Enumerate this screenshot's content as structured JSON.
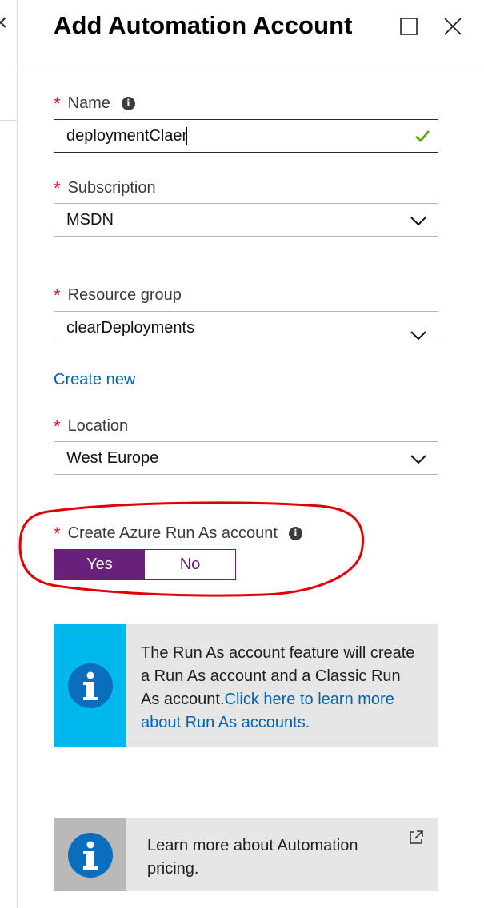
{
  "header": {
    "title": "Add Automation Account"
  },
  "form": {
    "name": {
      "label": "Name",
      "value": "deploymentClaer"
    },
    "subscription": {
      "label": "Subscription",
      "value": "MSDN"
    },
    "resource_group": {
      "label": "Resource group",
      "value": "clearDeployments",
      "create_new": "Create new"
    },
    "location": {
      "label": "Location",
      "value": "West Europe"
    },
    "run_as": {
      "label": "Create Azure Run As account",
      "yes": "Yes",
      "no": "No",
      "selected": "Yes"
    }
  },
  "info_boxes": {
    "run_as_text": "The Run As account feature will create a Run As account and a Classic Run As account.",
    "run_as_link": "Click here to learn more about Run As accounts.",
    "pricing_text": "Learn more about Automation pricing."
  },
  "colors": {
    "accent_purple": "#68217a",
    "link_blue": "#0063b1",
    "required_red": "#e81123",
    "info_cyan": "#00b7ee",
    "annotation_red": "#e00000",
    "valid_green": "#57a300"
  },
  "icons": [
    "close-icon",
    "maximize-icon",
    "info-icon",
    "checkmark-icon",
    "chevron-down-icon",
    "external-link-icon"
  ]
}
